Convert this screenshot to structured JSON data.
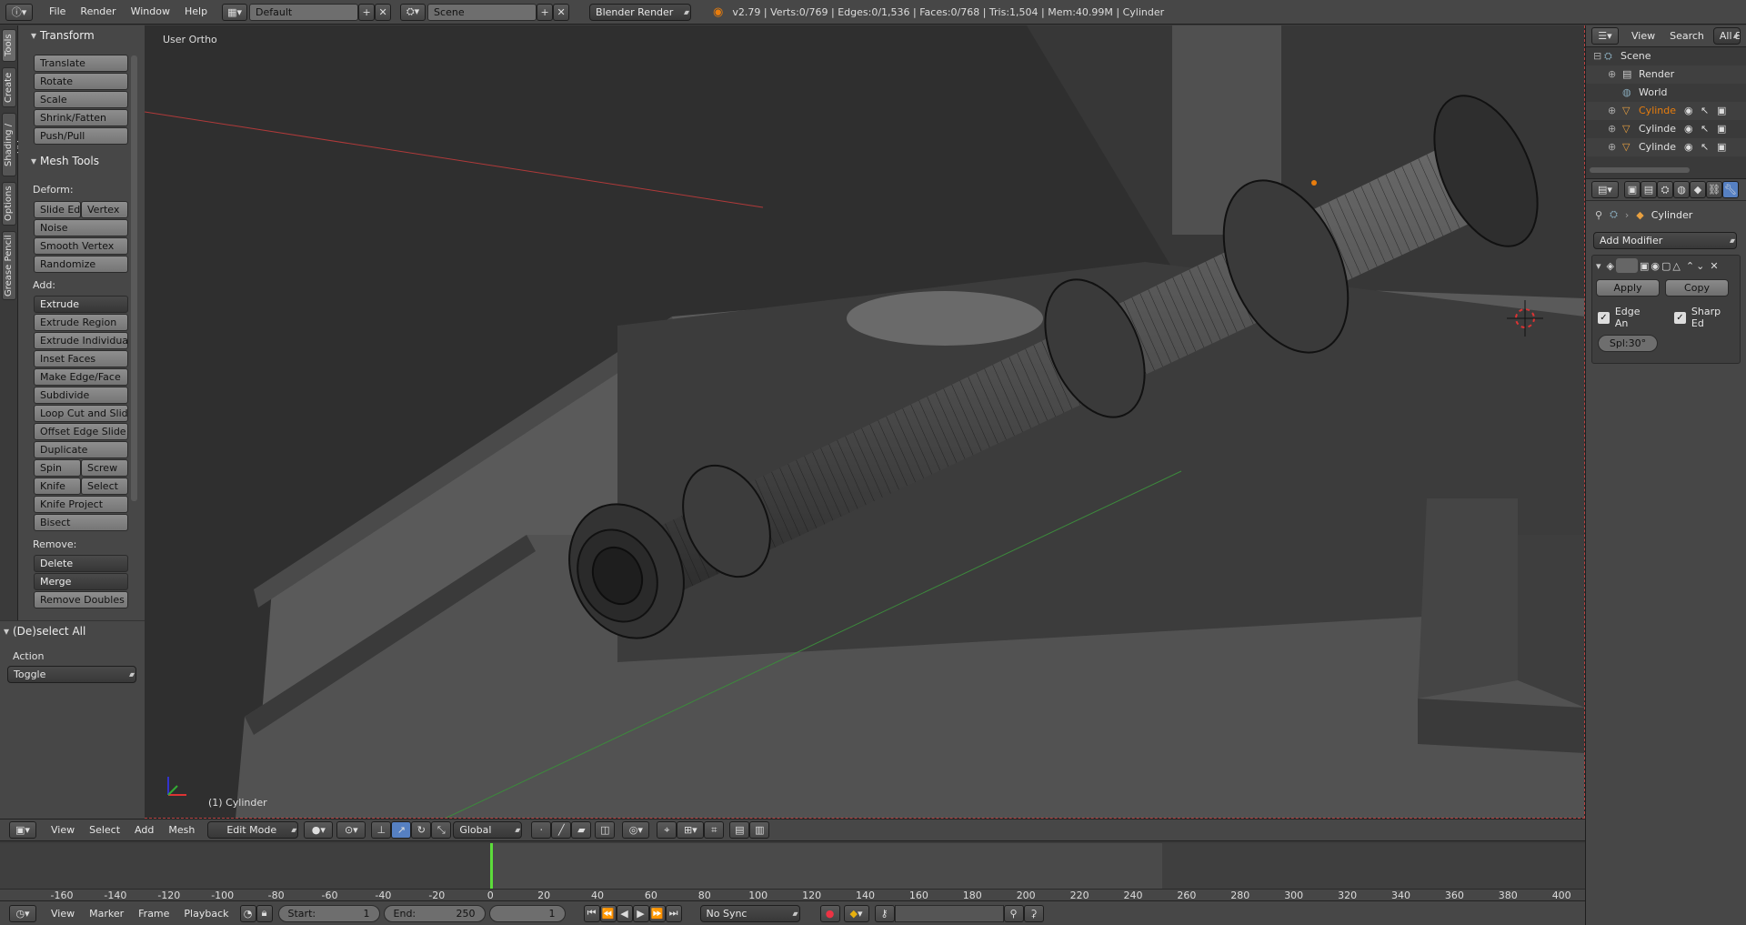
{
  "topbar": {
    "menus": [
      "File",
      "Render",
      "Window",
      "Help"
    ],
    "layout": "Default",
    "scene": "Scene",
    "engine": "Blender Render",
    "stats": "v2.79 | Verts:0/769 | Edges:0/1,536 | Faces:0/768 | Tris:1,504 | Mem:40.99M | Cylinder"
  },
  "tabs": [
    "Tools",
    "Create",
    "Shading / UVs",
    "Options",
    "Grease Pencil"
  ],
  "transform": {
    "title": "Transform",
    "buttons": [
      "Translate",
      "Rotate",
      "Scale",
      "Shrink/Fatten",
      "Push/Pull"
    ]
  },
  "mesh_tools": {
    "title": "Mesh Tools",
    "deform_label": "Deform:",
    "slide_edge": "Slide Ed",
    "vertex": "Vertex",
    "noise": "Noise",
    "smooth_vertex": "Smooth Vertex",
    "randomize": "Randomize",
    "add_label": "Add:",
    "extrude": "Extrude",
    "extrude_region": "Extrude Region",
    "extrude_individual": "Extrude Individual",
    "inset_faces": "Inset Faces",
    "make_edge_face": "Make Edge/Face",
    "subdivide": "Subdivide",
    "loop_cut": "Loop Cut and Slide",
    "offset_edge": "Offset Edge Slide",
    "duplicate": "Duplicate",
    "spin": "Spin",
    "screw": "Screw",
    "knife": "Knife",
    "select": "Select",
    "knife_project": "Knife Project",
    "bisect": "Bisect",
    "remove_label": "Remove:",
    "delete": "Delete",
    "merge": "Merge",
    "remove_doubles": "Remove Doubles"
  },
  "deselect": {
    "title": "(De)select All",
    "action_label": "Action",
    "action_value": "Toggle"
  },
  "viewport": {
    "view_label": "User Ortho",
    "object_label": "(1) Cylinder"
  },
  "view_header": {
    "menus": [
      "View",
      "Select",
      "Add",
      "Mesh"
    ],
    "mode": "Edit Mode",
    "orientation": "Global"
  },
  "timeline": {
    "ticks": [
      "-160",
      "-140",
      "-120",
      "-100",
      "-80",
      "-60",
      "-40",
      "-20",
      "0",
      "20",
      "40",
      "60",
      "80",
      "100",
      "120",
      "140",
      "160",
      "180",
      "200",
      "220",
      "240",
      "260",
      "280",
      "300",
      "320",
      "340",
      "360",
      "380",
      "400"
    ],
    "menus": [
      "View",
      "Marker",
      "Frame",
      "Playback"
    ],
    "start_label": "Start:",
    "start_value": "1",
    "end_label": "End:",
    "end_value": "250",
    "current_frame": "1",
    "sync": "No Sync"
  },
  "outliner": {
    "menus": [
      "View",
      "Search"
    ],
    "filter": "All S",
    "items": [
      "Scene",
      "Render",
      "World",
      "Cylinde",
      "Cylinde",
      "Cylinde"
    ]
  },
  "properties": {
    "object_name": "Cylinder",
    "add_modifier": "Add Modifier",
    "apply": "Apply",
    "copy": "Copy",
    "edge_angle": "Edge An",
    "sharp_edges": "Sharp Ed",
    "split_angle": "Spl:30°"
  },
  "colors": {
    "accent_orange": "#e87d0d",
    "playhead_green": "#5cdc3a",
    "axis_red": "#b03a3a",
    "axis_green": "#3c8a3c"
  }
}
